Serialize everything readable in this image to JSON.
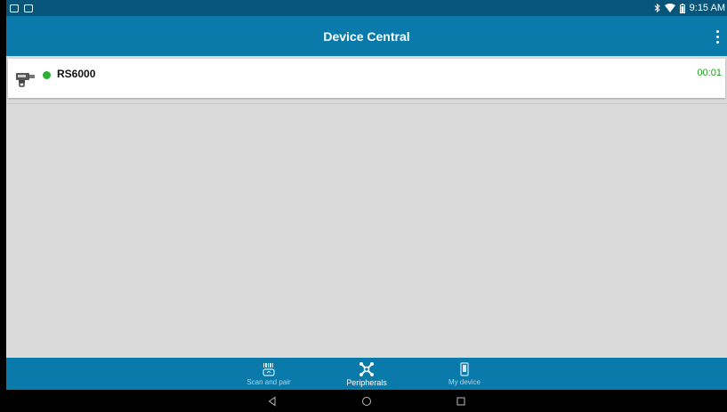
{
  "status_bar": {
    "time": "9:15 AM",
    "left_icons": [
      "notification-icon",
      "notification-icon"
    ],
    "right_icons": [
      "bluetooth-icon",
      "wifi-icon",
      "battery-icon"
    ]
  },
  "app_bar": {
    "title": "Device Central",
    "menu_icon": "overflow-menu-icon",
    "color": "#0a7aaa"
  },
  "devices": [
    {
      "name": "RS6000",
      "status": "connected",
      "status_color": "#2fae3a",
      "time": "00:01",
      "icon": "ring-scanner-icon"
    }
  ],
  "bottom_nav": {
    "items": [
      {
        "label": "Scan and pair",
        "icon": "barcode-icon",
        "active": false
      },
      {
        "label": "Peripherals",
        "icon": "peripherals-icon",
        "active": true
      },
      {
        "label": "My device",
        "icon": "phone-icon",
        "active": false
      }
    ]
  },
  "system_nav": [
    "back-icon",
    "home-icon",
    "recents-icon"
  ]
}
